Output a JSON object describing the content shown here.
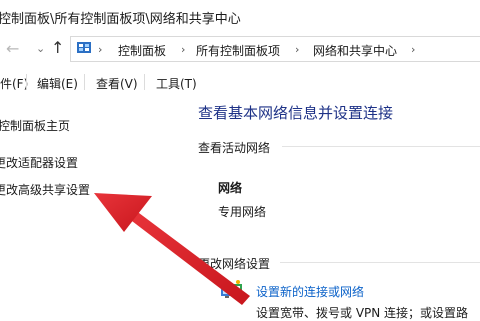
{
  "window": {
    "title": "控制面板\\所有控制面板项\\网络和共享中心"
  },
  "nav": {
    "back_icon": "arrow-left-icon",
    "forward_icon": "arrow-right-icon",
    "up_icon": "arrow-up-icon",
    "breadcrumb": [
      "控制面板",
      "所有控制面板项",
      "网络和共享中心"
    ]
  },
  "menu": {
    "items": [
      "件(F)",
      "编辑(E)",
      "查看(V)",
      "工具(T)"
    ]
  },
  "sidebar": {
    "items": [
      "控制面板主页",
      "更改适配器设置",
      "更改高级共享设置"
    ]
  },
  "main": {
    "heading": "查看基本网络信息并设置连接",
    "active_networks_label": "查看活动网络",
    "network_name": "网络",
    "network_type": "专用网络",
    "change_settings_label": "更改网络设置",
    "new_connection_link": "设置新的连接或网络",
    "new_connection_desc": "设置宽带、拨号或 VPN 连接；或设置路"
  },
  "colors": {
    "heading": "#1e3287",
    "link": "#0b62c9",
    "arrow": "#d9232a"
  }
}
